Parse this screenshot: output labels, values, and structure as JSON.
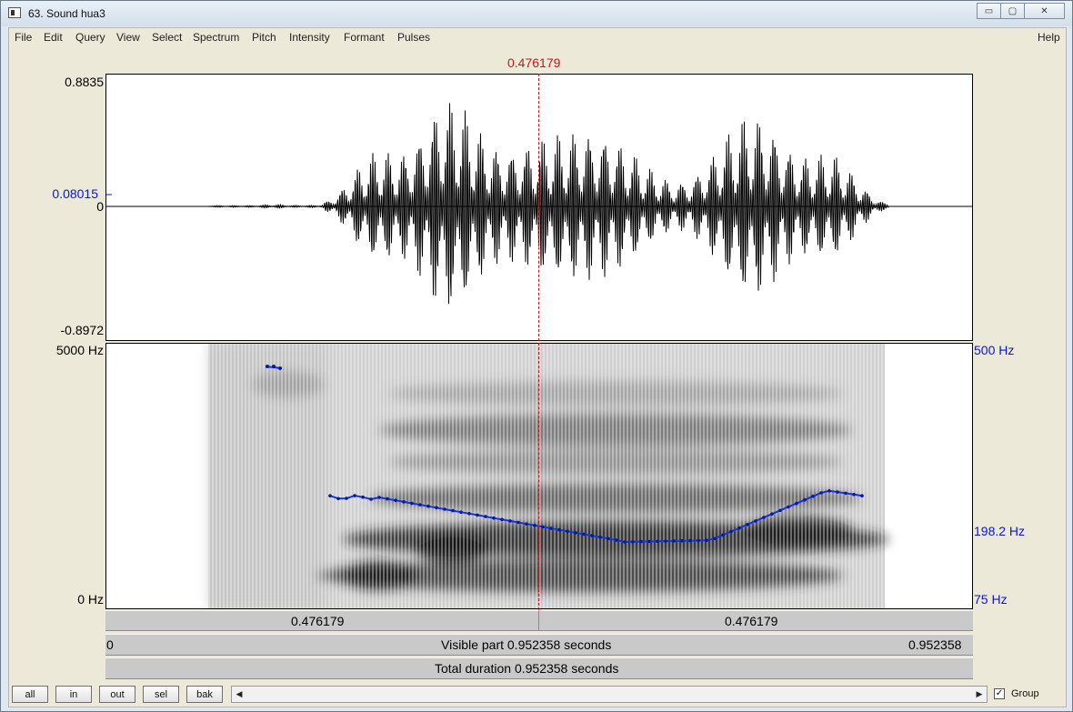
{
  "window": {
    "title": "63. Sound hua3",
    "minimize": "▭",
    "maximize": "▢",
    "close": "✕"
  },
  "menu": [
    "File",
    "Edit",
    "Query",
    "View",
    "Select",
    "Spectrum",
    "Pitch",
    "Intensity",
    "Formant",
    "Pulses"
  ],
  "help": "Help",
  "cursor_time": "0.476179",
  "waveform": {
    "ymax": "0.8835",
    "ymin": "-0.8972",
    "zero": "0",
    "cursor_value": "0.08015"
  },
  "spectrogram": {
    "fmax": "5000 Hz",
    "fmin": "0 Hz",
    "pitch_max": "500 Hz",
    "pitch_mid": "198.2 Hz",
    "pitch_min": "75 Hz"
  },
  "time_bar": {
    "left_segment": "0.476179",
    "right_segment": "0.476179"
  },
  "visible_bar": {
    "start": "0",
    "label": "Visible part 0.952358 seconds",
    "end": "0.952358"
  },
  "total_bar": {
    "label": "Total duration 0.952358 seconds"
  },
  "buttons": {
    "all": "all",
    "in": "in",
    "out": "out",
    "sel": "sel",
    "bak": "bak"
  },
  "group": {
    "label": "Group",
    "checked": true,
    "mark": "✓"
  },
  "scroll": {
    "left": "◀",
    "right": "▶"
  }
}
